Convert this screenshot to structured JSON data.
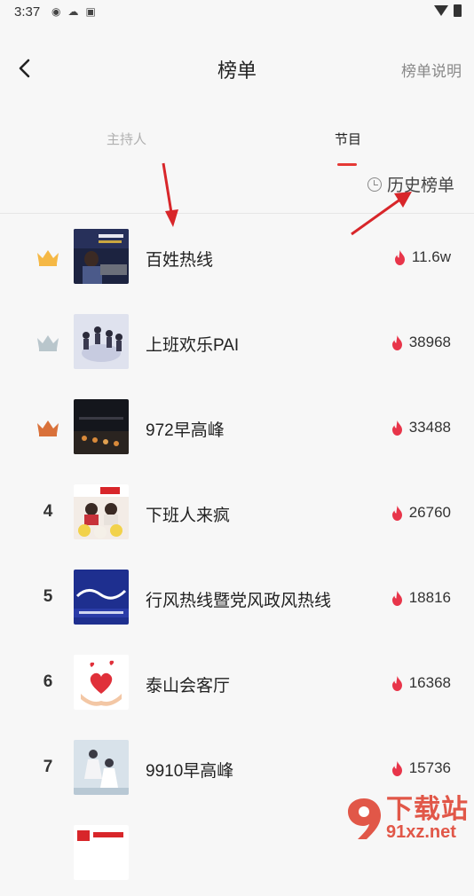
{
  "status_bar": {
    "time": "3:37",
    "icons": [
      "weibo-icon",
      "cloud-icon",
      "a-icon"
    ]
  },
  "header": {
    "title": "榜单",
    "help_label": "榜单说明"
  },
  "tabs": [
    {
      "label": "主持人",
      "active": false
    },
    {
      "label": "节目",
      "active": true
    }
  ],
  "history": {
    "label": "历史榜单"
  },
  "rankings": [
    {
      "rank": "1",
      "crown": "gold",
      "name": "百姓热线",
      "heat": "11.6w"
    },
    {
      "rank": "2",
      "crown": "silver",
      "name": "上班欢乐PAI",
      "heat": "38968"
    },
    {
      "rank": "3",
      "crown": "bronze",
      "name": "972早高峰",
      "heat": "33488"
    },
    {
      "rank": "4",
      "crown": null,
      "name": "下班人来疯",
      "heat": "26760"
    },
    {
      "rank": "5",
      "crown": null,
      "name": "行风热线暨党风政风热线",
      "heat": "18816"
    },
    {
      "rank": "6",
      "crown": null,
      "name": "泰山会客厅",
      "heat": "16368"
    },
    {
      "rank": "7",
      "crown": null,
      "name": "9910早高峰",
      "heat": "15736"
    }
  ],
  "colors": {
    "accent": "#e53935",
    "flame": "#e8354a",
    "gold": "#f5b845",
    "silver": "#b9c6cc",
    "bronze": "#d9713a"
  },
  "watermark": {
    "cn": "下载站",
    "en": "91xz.net"
  }
}
